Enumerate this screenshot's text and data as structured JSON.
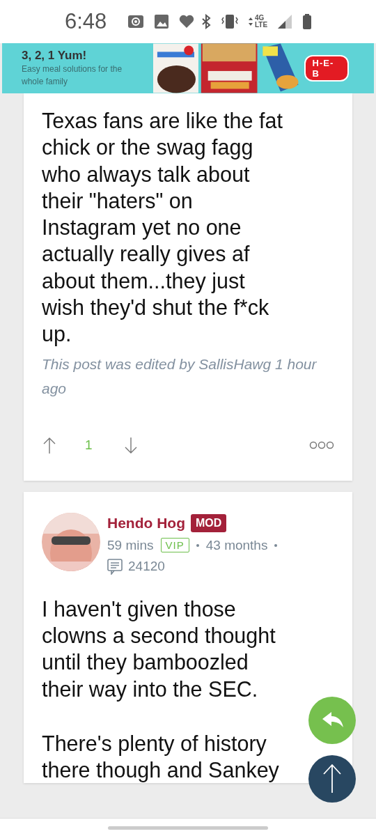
{
  "status_bar": {
    "time": "6:48",
    "network": "4G LTE"
  },
  "ad_banner": {
    "headline": "3, 2, 1 Yum!",
    "tagline": "Easy meal solutions for the whole family",
    "brand": "H-E-B",
    "kind": "picture"
  },
  "posts": [
    {
      "body": [
        [
          "Texas fans are like the fat",
          "chick or the swag fagg",
          "who always talk about",
          "their \"haters\" on",
          "Instagram yet no one",
          "actually really gives af",
          "about them...they just",
          "wish they'd shut the f*ck",
          "up."
        ]
      ],
      "edit_note": "This post was edited by SallisHawg 1 hour ago",
      "vote_count": "1"
    },
    {
      "author": "Hendo Hog",
      "role_badge": "MOD",
      "time": "59 mins",
      "member_tag": "VIP",
      "tenure": "43 months",
      "post_count": "24120",
      "body": [
        [
          "I haven't given those",
          "clowns a second thought",
          "until they bamboozled",
          "their way into the SEC."
        ],
        [
          "There's plenty of history",
          "there though and Sankey"
        ]
      ]
    }
  ]
}
